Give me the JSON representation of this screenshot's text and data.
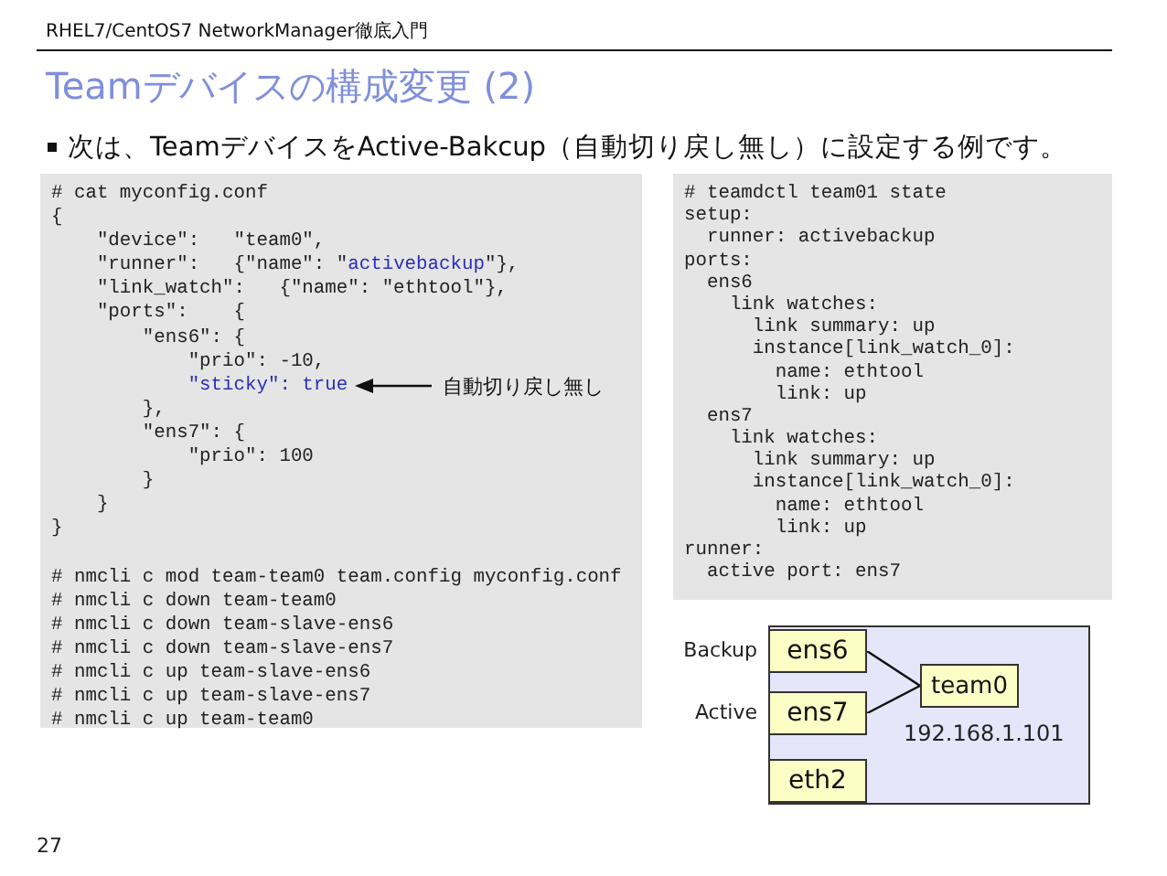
{
  "header": {
    "title": "RHEL7/CentOS7 NetworkManager徹底入門"
  },
  "slide_title": "Teamデバイスの構成変更 (2)",
  "bullets": [
    "次は、TeamデバイスをActive-Bakcup（自動切り戻し無し）に設定する例です。"
  ],
  "config_code": [
    [
      {
        "text": "# cat myconfig.conf",
        "kind": "plain"
      }
    ],
    [
      {
        "text": "{",
        "kind": "plain"
      }
    ],
    [
      {
        "text": "    \"device\":   \"team0\",",
        "kind": "plain"
      }
    ],
    [
      {
        "text": "    \"runner\":   {\"name\": \"",
        "kind": "plain"
      },
      {
        "text": "activebackup",
        "kind": "highlight"
      },
      {
        "text": "\"},",
        "kind": "plain"
      }
    ],
    [
      {
        "text": "    \"link_watch\":   {\"name\": \"ethtool\"},",
        "kind": "plain"
      }
    ],
    [
      {
        "text": "    \"ports\":    {",
        "kind": "plain"
      }
    ],
    [
      {
        "text": "        \"ens6\": {",
        "kind": "plain"
      }
    ],
    [
      {
        "text": "            \"prio\": -10,",
        "kind": "plain"
      }
    ],
    [
      {
        "text": "            \"sticky\": true",
        "kind": "highlight"
      },
      {
        "text": "自動切り戻し無し",
        "kind": "annotation"
      }
    ],
    [
      {
        "text": "        },",
        "kind": "plain"
      }
    ],
    [
      {
        "text": "        \"ens7\": {",
        "kind": "plain"
      }
    ],
    [
      {
        "text": "            \"prio\": 100",
        "kind": "plain"
      }
    ],
    [
      {
        "text": "        }",
        "kind": "plain"
      }
    ],
    [
      {
        "text": "    }",
        "kind": "plain"
      }
    ],
    [
      {
        "text": "}",
        "kind": "plain"
      }
    ]
  ],
  "commands": [
    [
      {
        "text": "# nmcli c mod team-team0 team.config myconfig.conf",
        "kind": "plain"
      }
    ],
    [
      {
        "text": "# nmcli c down team-team0",
        "kind": "plain"
      }
    ],
    [
      {
        "text": "# nmcli c down team-slave-ens6",
        "kind": "plain"
      }
    ],
    [
      {
        "text": "# nmcli c down team-slave-ens7",
        "kind": "plain"
      }
    ],
    [
      {
        "text": "# nmcli c up team-slave-ens6",
        "kind": "plain"
      }
    ],
    [
      {
        "text": "# nmcli c up team-slave-ens7",
        "kind": "plain"
      }
    ],
    [
      {
        "text": "# nmcli c up team-team0",
        "kind": "plain"
      }
    ]
  ],
  "state_code": [
    "# teamdctl team01 state",
    "setup:",
    "  runner: activebackup",
    "ports:",
    "  ens6",
    "    link watches:",
    "      link summary: up",
    "      instance[link_watch_0]:",
    "        name: ethtool",
    "        link: up",
    "  ens7",
    "    link watches:",
    "      link summary: up",
    "      instance[link_watch_0]:",
    "        name: ethtool",
    "        link: up",
    "runner:",
    "  active port: ens7"
  ],
  "diagram": {
    "team": "team0",
    "address": "192.168.1.101",
    "ports": [
      {
        "name": "ens6",
        "role": "Backup",
        "connected": true
      },
      {
        "name": "ens7",
        "role": "Active",
        "connected": true
      },
      {
        "name": "eth2",
        "connected": false
      }
    ]
  },
  "page_number": "27"
}
